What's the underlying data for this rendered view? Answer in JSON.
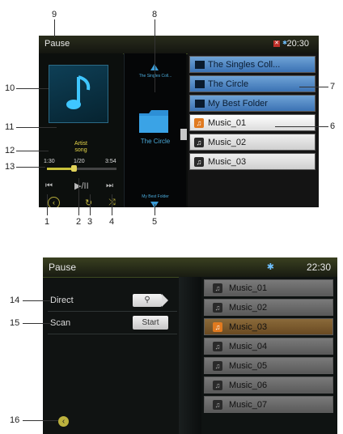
{
  "top": {
    "status_title": "Pause",
    "clock": "20:30",
    "song_artist": "Artist",
    "song_title": "song",
    "time_elapsed": "1:30",
    "track_counter": "1/20",
    "time_total": "3:54",
    "progress_fraction": 0.38,
    "up_label": "The Singles Coll...",
    "current_folder": "The Circle",
    "down_label": "My Best Folder",
    "list": [
      {
        "type": "folder",
        "label": "The Singles Coll..."
      },
      {
        "type": "folder",
        "label": "The Circle"
      },
      {
        "type": "folder",
        "label": "My Best Folder"
      },
      {
        "type": "song",
        "label": "Music_01",
        "selected": true
      },
      {
        "type": "song",
        "label": "Music_02"
      },
      {
        "type": "song",
        "label": "Music_03"
      }
    ],
    "controls": {
      "prev_icon": "previous-track-icon",
      "play_pause_icon": "play-pause-icon",
      "repeat_icon": "repeat-icon",
      "shuffle_icon": "shuffle-icon",
      "next_icon": "next-track-icon",
      "back_icon": "back-arrow-icon"
    }
  },
  "bottom": {
    "status_title": "Pause",
    "clock": "22:30",
    "bt_icon": "bluetooth-icon",
    "direct_label": "Direct",
    "scan_label": "Scan",
    "start_button": "Start",
    "search_icon": "search-icon",
    "back_icon": "back-arrow-icon",
    "list": [
      {
        "label": "Music_01"
      },
      {
        "label": "Music_02"
      },
      {
        "label": "Music_03",
        "highlighted": true
      },
      {
        "label": "Music_04"
      },
      {
        "label": "Music_05"
      },
      {
        "label": "Music_06"
      },
      {
        "label": "Music_07"
      }
    ]
  },
  "callouts": {
    "n1": "1",
    "n2": "2",
    "n3": "3",
    "n4": "4",
    "n5": "5",
    "n6": "6",
    "n7": "7",
    "n8": "8",
    "n9": "9",
    "n10": "10",
    "n11": "11",
    "n12": "12",
    "n13": "13",
    "n14": "14",
    "n15": "15",
    "n16": "16"
  },
  "colors": {
    "accent_yellow": "#c9c23a",
    "folder_blue": "#3b72b4",
    "highlight_orange": "#e07a20"
  }
}
